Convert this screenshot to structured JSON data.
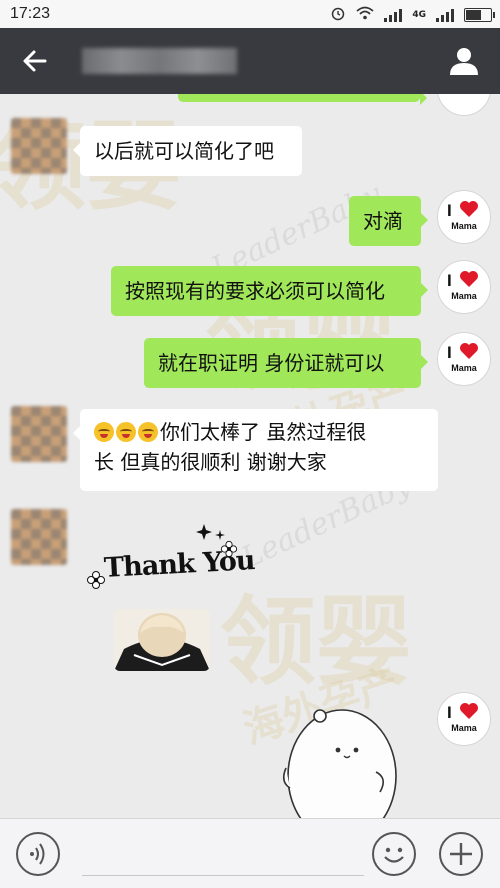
{
  "status_bar": {
    "time": "17:23",
    "network": "4G"
  },
  "chat": {
    "messages": [
      {
        "from": "other",
        "text": "以后就可以简化了吧"
      },
      {
        "from": "me",
        "text": "对滴"
      },
      {
        "from": "me",
        "text": "按照现有的要求必须可以简化"
      },
      {
        "from": "me",
        "text": "就在职证明 身份证就可以"
      },
      {
        "from": "other",
        "line1": "你们太棒了 虽然过程很",
        "line2": "长 但真的很顺利 谢谢大家"
      },
      {
        "from": "other",
        "sticker_text": "Thank You"
      }
    ],
    "my_avatar": {
      "letter": "I",
      "label": "Mama"
    }
  },
  "watermark": {
    "latin": "LeaderBaby",
    "big": "领婴",
    "small": "海外孕产"
  },
  "colors": {
    "topbar": "#393a3f",
    "bubble_out": "#a0e759",
    "bubble_in": "#ffffff",
    "background": "#ebebeb"
  },
  "icons": {
    "back": "arrow-left",
    "profile": "person",
    "voice": "voice-wave",
    "emoji": "smiley",
    "more": "plus"
  }
}
